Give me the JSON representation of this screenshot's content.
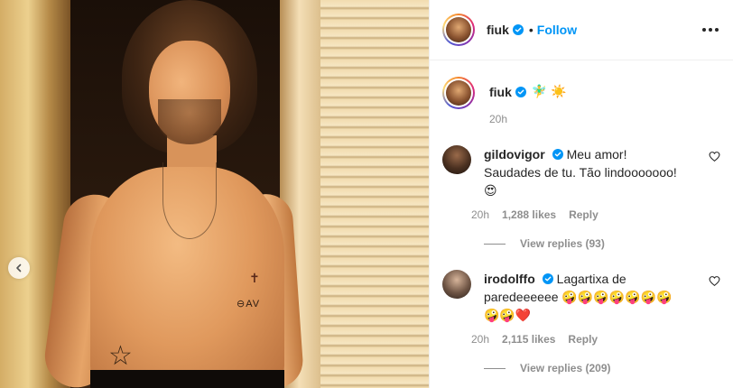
{
  "post": {
    "author": "fiuk",
    "follow_label": "Follow",
    "dot": "•",
    "caption_emoji": "🧚‍♂️ ☀️",
    "time_ago": "20h"
  },
  "comments": [
    {
      "username": "gildovigor",
      "text": "Meu amor! Saudades de tu. Tão lindooooooo! 😍",
      "time": "20h",
      "likes": "1,288 likes",
      "reply_label": "Reply",
      "view_replies": "View replies (93)"
    },
    {
      "username": "irodolffo",
      "text": "Lagartixa de paredeeeeee 🤪🤪🤪🤪🤪🤪🤪🤪🤪❤️",
      "time": "20h",
      "likes": "2,115 likes",
      "reply_label": "Reply",
      "view_replies": "View replies (209)"
    }
  ],
  "media": {
    "tattoo_text": "⊖AV",
    "tattoo_star": "☆",
    "tattoo_cross": "✝"
  },
  "colors": {
    "accent": "#0095f6",
    "verified": "#0095f6",
    "muted": "#8e8e8e",
    "text": "#262626"
  },
  "icons": [
    "chevron-left-icon",
    "verified-badge-icon",
    "more-options-icon",
    "heart-outline-icon"
  ]
}
